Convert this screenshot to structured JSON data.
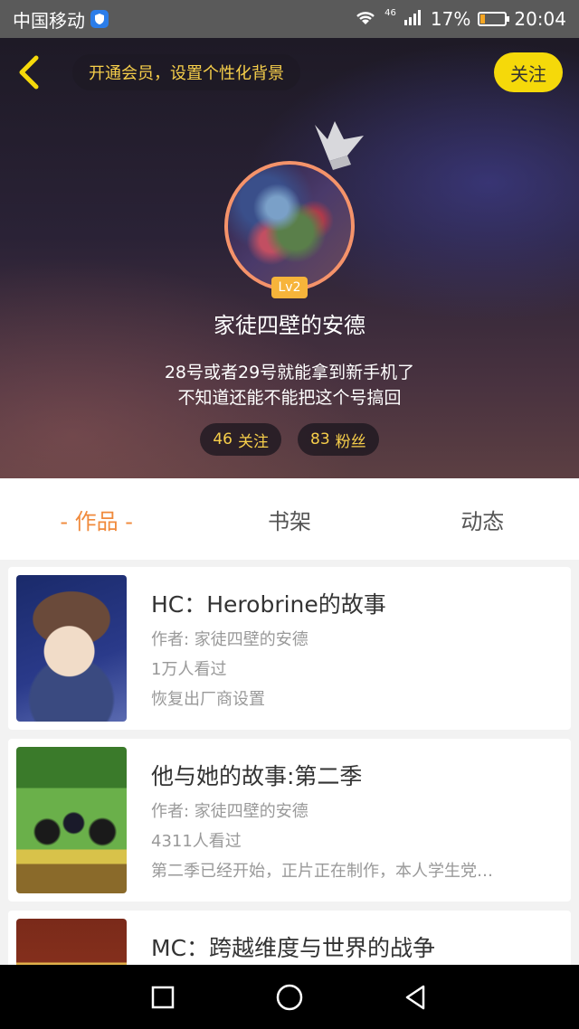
{
  "status_bar": {
    "carrier": "中国移动",
    "network": "46",
    "battery_percent_text": "17%",
    "battery_level": 0.17,
    "time": "20:04"
  },
  "header": {
    "vip_text": "开通会员，设置个性化背景",
    "follow_label": "关注",
    "level": "Lv2",
    "username": "家徒四壁的安德",
    "bio_line1": "28号或者29号就能拿到新手机了",
    "bio_line2": "不知道还能不能把这个号搞回",
    "following_count": "46",
    "following_label": "关注",
    "fans_count": "83",
    "fans_label": "粉丝"
  },
  "tabs": [
    {
      "label": "- 作品 -",
      "active": true
    },
    {
      "label": "书架",
      "active": false
    },
    {
      "label": "动态",
      "active": false
    }
  ],
  "works": [
    {
      "title": "HC：Herobrine的故事",
      "author": "作者: 家徒四壁的安德",
      "views": "1万人看过",
      "desc": "恢复出厂商设置"
    },
    {
      "title": "他与她的故事:第二季",
      "author": "作者: 家徒四壁的安德",
      "views": "4311人看过",
      "desc": "第二季已经开始，正片正在制作，本人学生党…"
    },
    {
      "title": "MC：跨越维度与世界的战争",
      "author": "",
      "views": "",
      "desc": ""
    }
  ],
  "colors": {
    "accent": "#f08a3c",
    "follow_button": "#f5d90a",
    "stat_text": "#f7cf4a"
  },
  "icons": {
    "back": "chevron-left-icon",
    "crown": "crown-icon",
    "nav_recent": "square-icon",
    "nav_home": "circle-icon",
    "nav_back": "triangle-back-icon"
  }
}
